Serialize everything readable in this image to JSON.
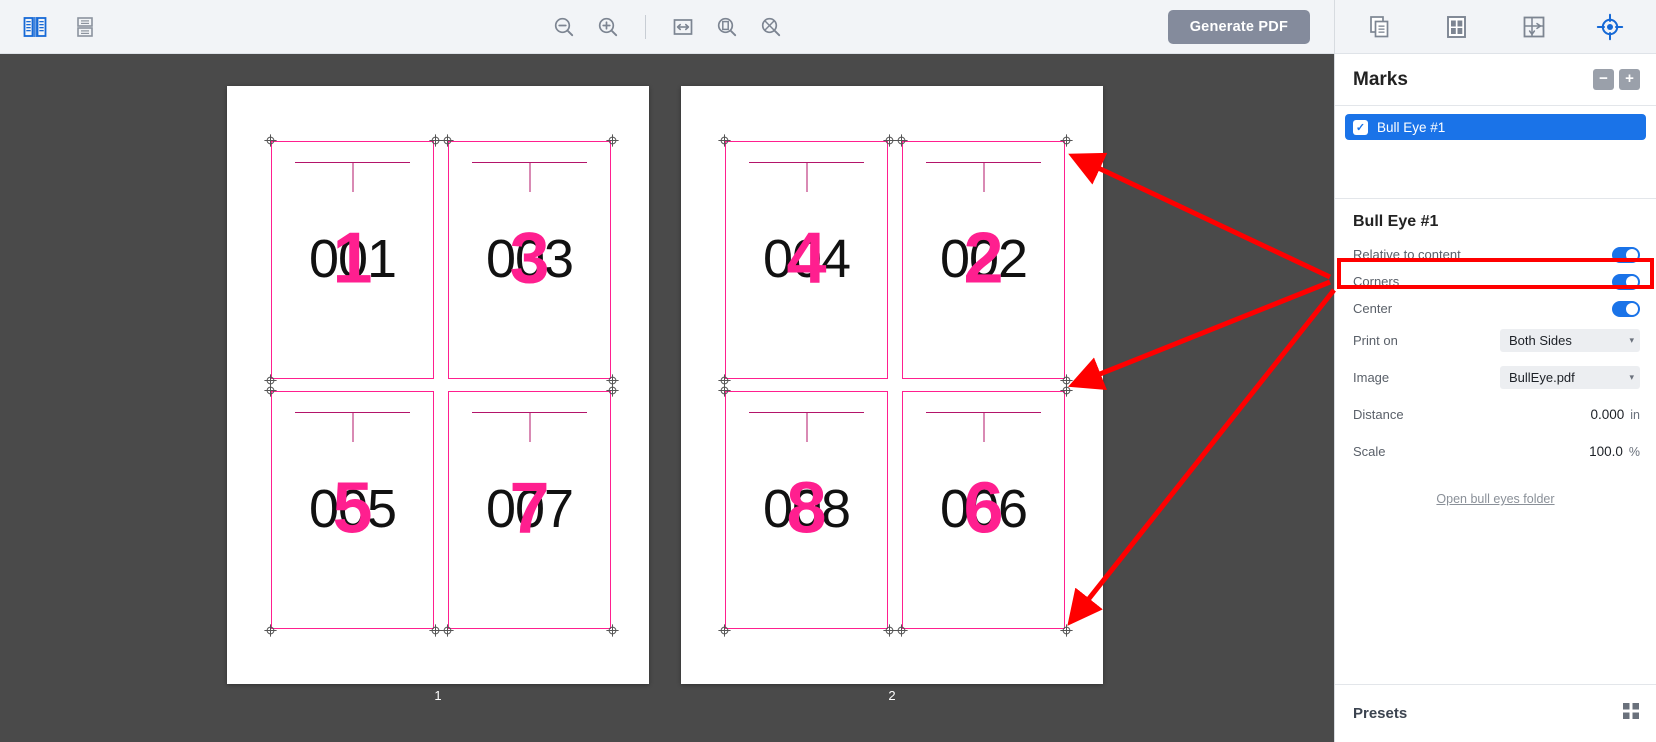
{
  "toolbar": {
    "left_icons": [
      {
        "name": "two-page-spread-view-icon",
        "active": true
      },
      {
        "name": "stacked-pages-view-icon",
        "active": false
      }
    ],
    "center_icons": [
      {
        "name": "zoom-out-icon"
      },
      {
        "name": "zoom-in-icon"
      },
      {
        "name": "fit-width-icon"
      },
      {
        "name": "fit-page-icon"
      },
      {
        "name": "actual-size-icon"
      }
    ],
    "generate_pdf_label": "Generate PDF"
  },
  "canvas": {
    "sheets": [
      {
        "page_number": "1",
        "cards": [
          {
            "black_number": "001",
            "pink_number": "1"
          },
          {
            "black_number": "003",
            "pink_number": "3"
          },
          {
            "black_number": "005",
            "pink_number": "5"
          },
          {
            "black_number": "007",
            "pink_number": "7"
          }
        ]
      },
      {
        "page_number": "2",
        "cards": [
          {
            "black_number": "004",
            "pink_number": "4"
          },
          {
            "black_number": "002",
            "pink_number": "2"
          },
          {
            "black_number": "008",
            "pink_number": "8"
          },
          {
            "black_number": "006",
            "pink_number": "6"
          }
        ]
      }
    ]
  },
  "panel": {
    "tabs": [
      {
        "name": "pages-tab-icon",
        "active": false
      },
      {
        "name": "imposition-grid-tab-icon",
        "active": false
      },
      {
        "name": "sheet-layout-tab-icon",
        "active": false
      },
      {
        "name": "marks-tab-icon",
        "active": true
      }
    ],
    "header": {
      "title": "Marks",
      "remove_label": "−",
      "add_label": "+"
    },
    "marks": [
      {
        "label": "Bull Eye #1",
        "checked": true,
        "check_glyph": "✓"
      }
    ],
    "properties": {
      "title": "Bull Eye #1",
      "rows": [
        {
          "label": "Relative to content",
          "type": "toggle",
          "value": "on"
        },
        {
          "label": "Corners",
          "type": "toggle",
          "value": "on"
        },
        {
          "label": "Center",
          "type": "toggle",
          "value": "on"
        },
        {
          "label": "Print on",
          "type": "select",
          "value": "Both Sides",
          "caret": "▾"
        },
        {
          "label": "Image",
          "type": "select",
          "value": "BullEye.pdf",
          "caret": "▾"
        },
        {
          "label": "Distance",
          "type": "number",
          "value": "0.000",
          "unit": "in"
        },
        {
          "label": "Scale",
          "type": "number",
          "value": "100.0",
          "unit": "%"
        }
      ],
      "folder_link": "Open bull eyes folder"
    },
    "presets": {
      "title": "Presets",
      "icon": "presets-grid-icon"
    }
  },
  "annotations": {
    "highlight_label": "Relative to content highlight box",
    "color": "#ff0000",
    "arrow_count": 3
  },
  "colors": {
    "accent_blue": "#1a73e8",
    "mark_pink": "#ff1f8f",
    "canvas_bg": "#4a4a4a",
    "toolbar_bg": "#f2f4f7",
    "annotation_red": "#ff0000",
    "generate_btn": "#848b9c"
  }
}
